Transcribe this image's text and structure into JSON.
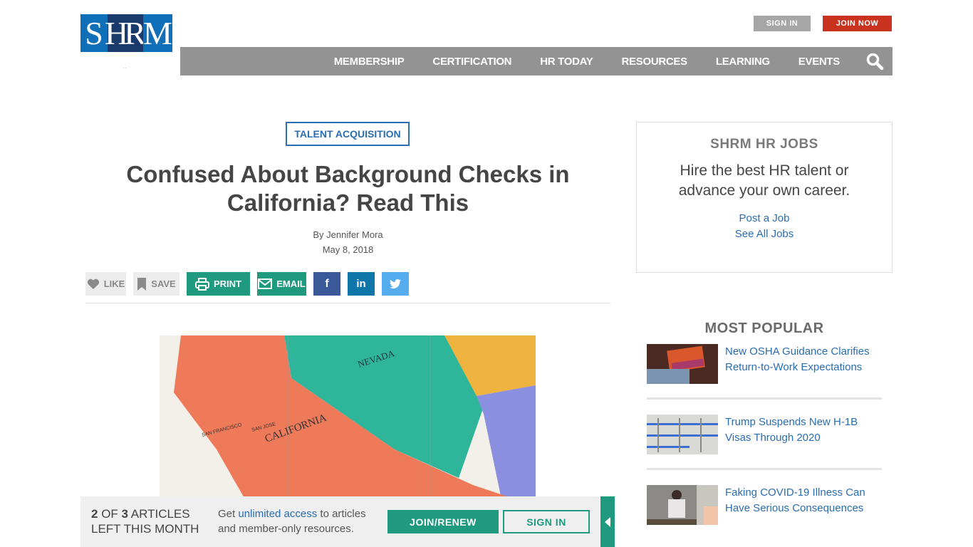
{
  "header": {
    "logo": {
      "s": "S",
      "hr": "HR",
      "m": "M",
      "sub": "··"
    },
    "sign_in_label": "SIGN IN",
    "join_now_label": "JOIN NOW",
    "nav": [
      "MEMBERSHIP",
      "CERTIFICATION",
      "HR TODAY",
      "RESOURCES",
      "LEARNING",
      "EVENTS"
    ],
    "search_icon": "search-icon"
  },
  "article": {
    "tag": "TALENT ACQUISITION",
    "title": "Confused About Background Checks in California? Read This",
    "author": "By Jennifer Mora",
    "date": "May 8, 2018",
    "actions": {
      "like": "LIKE",
      "save": "SAVE",
      "print": "PRINT",
      "email": "EMAIL",
      "facebook_icon": "f",
      "linkedin_icon": "in"
    },
    "hero_alt": "Map of California and Nevada",
    "hero_labels": {
      "nevada": "NEVADA",
      "california": "CALIFORNIA",
      "sf": "SAN FRANCISCO",
      "sj": "SAN JOSE"
    }
  },
  "sidebar": {
    "jobs": {
      "title": "SHRM HR JOBS",
      "text": "Hire the best HR talent or advance your own career.",
      "links": [
        "Post a Job",
        "See All Jobs"
      ]
    },
    "popular": {
      "title": "MOST POPULAR",
      "items": [
        {
          "title": "New OSHA Guidance Clarifies Return-to-Work Expectations"
        },
        {
          "title": "Trump Suspends New H-1B Visas Through 2020"
        },
        {
          "title": "Faking COVID-19 Illness Can Have Serious Consequences"
        }
      ]
    }
  },
  "meter": {
    "used": "2",
    "of": " OF ",
    "total": "3",
    "line1_rest": " ARTICLES",
    "line2": "LEFT THIS MONTH",
    "msg_prefix": "Get ",
    "msg_link": "unlimited access",
    "msg_suffix": " to articles",
    "msg_line2": "and member-only resources.",
    "join_label": "JOIN/RENEW",
    "signin_label": "SIGN IN"
  },
  "colors": {
    "brand_blue": "#0f6fb8",
    "brand_navy": "#1a3a6b",
    "join_red": "#c8321e",
    "teal": "#1f9a7f",
    "link_blue": "#2a6db3"
  }
}
